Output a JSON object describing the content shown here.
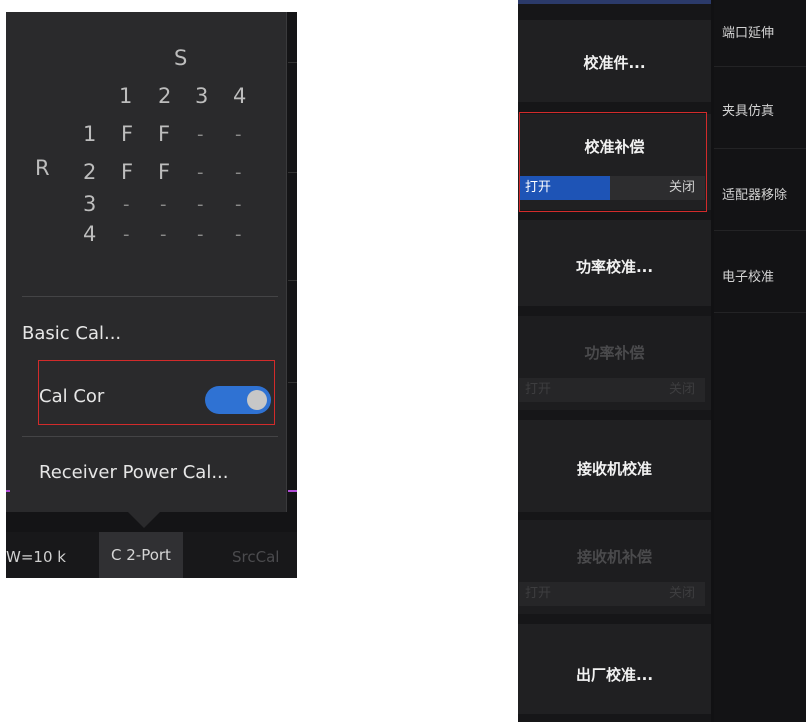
{
  "sparam": {
    "s_label": "S",
    "r_label": "R",
    "cols": [
      "1",
      "2",
      "3",
      "4"
    ],
    "rows": [
      {
        "label": "1",
        "cells": [
          "F",
          "F",
          "-",
          "-"
        ]
      },
      {
        "label": "2",
        "cells": [
          "F",
          "F",
          "-",
          "-"
        ]
      },
      {
        "label": "3",
        "cells": [
          "-",
          "-",
          "-",
          "-"
        ]
      },
      {
        "label": "4",
        "cells": [
          "-",
          "-",
          "-",
          "-"
        ]
      }
    ]
  },
  "menu": {
    "basic_cal": "Basic Cal...",
    "cal_cor": "Cal Cor",
    "cal_cor_state": "on",
    "receiver_power_cal": "Receiver Power Cal..."
  },
  "status": {
    "bw": "W=10 k",
    "cal_type": "C 2-Port",
    "src_cal": "SrcCal"
  },
  "softkeys": {
    "cal_kit": "校准件...",
    "cal_cor": "校准补偿",
    "cal_cor_on": "打开",
    "cal_cor_off": "关闭",
    "power_cal": "功率校准...",
    "power_comp": "功率补偿",
    "power_comp_on": "打开",
    "power_comp_off": "关闭",
    "receiver_cal": "接收机校准",
    "receiver_comp": "接收机补偿",
    "receiver_comp_on": "打开",
    "receiver_comp_off": "关闭",
    "factory_cal": "出厂校准..."
  },
  "submenu": {
    "items": [
      "端口延伸",
      "夹具仿真",
      "适配器移除",
      "电子校准"
    ]
  },
  "colors": {
    "accent_blue": "#2f72d3",
    "highlight_red": "#d22b2b",
    "trace_magenta": "#b14bd6"
  }
}
